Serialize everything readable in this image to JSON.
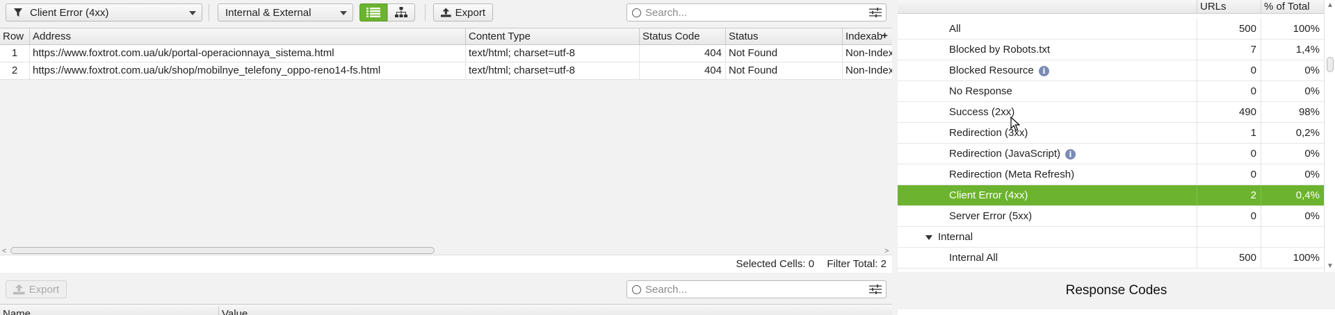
{
  "toolbar": {
    "filter_select": "Client Error (4xx)",
    "scope_select": "Internal & External",
    "export_label": "Export",
    "search_placeholder": "Search..."
  },
  "grid": {
    "columns": [
      "Row",
      "Address",
      "Content Type",
      "Status Code",
      "Status",
      "Indexab"
    ],
    "rows": [
      {
        "row": "1",
        "address": "https://www.foxtrot.com.ua/uk/portal-operacionnaya_sistema.html",
        "content_type": "text/html; charset=utf-8",
        "status_code": "404",
        "status": "Not Found",
        "indexability": "Non-Indexable"
      },
      {
        "row": "2",
        "address": "https://www.foxtrot.com.ua/uk/shop/mobilnye_telefony_oppo-reno14-fs.html",
        "content_type": "text/html; charset=utf-8",
        "status_code": "404",
        "status": "Not Found",
        "indexability": "Non-Indexable"
      }
    ]
  },
  "statusbar": {
    "selected_label": "Selected Cells:",
    "selected_value": "0",
    "filter_label": "Filter Total:",
    "filter_value": "2"
  },
  "lower": {
    "export_label": "Export",
    "search_placeholder": "Search...",
    "col_name": "Name",
    "col_value": "Value"
  },
  "overview": {
    "col_urls": "URLs",
    "col_pct": "% of Total",
    "rows": [
      {
        "label": "All",
        "urls": "500",
        "pct": "100%"
      },
      {
        "label": "Blocked by Robots.txt",
        "urls": "7",
        "pct": "1,4%"
      },
      {
        "label": "Blocked Resource",
        "urls": "0",
        "pct": "0%",
        "info": true
      },
      {
        "label": "No Response",
        "urls": "0",
        "pct": "0%"
      },
      {
        "label": "Success (2xx)",
        "urls": "490",
        "pct": "98%"
      },
      {
        "label": "Redirection (3xx)",
        "urls": "1",
        "pct": "0,2%"
      },
      {
        "label": "Redirection (JavaScript)",
        "urls": "0",
        "pct": "0%",
        "info": true
      },
      {
        "label": "Redirection (Meta Refresh)",
        "urls": "0",
        "pct": "0%"
      },
      {
        "label": "Client Error (4xx)",
        "urls": "2",
        "pct": "0,4%",
        "selected": true
      },
      {
        "label": "Server Error (5xx)",
        "urls": "0",
        "pct": "0%"
      },
      {
        "label": "Internal",
        "urls": "",
        "pct": "",
        "group": true
      },
      {
        "label": "Internal All",
        "urls": "500",
        "pct": "100%"
      }
    ],
    "panel_title": "Response Codes"
  },
  "colors": {
    "accent_green": "#6cb32f",
    "info_icon": "#7b8bb5"
  },
  "icons": {
    "filter": "funnel-icon",
    "list_view": "list-icon",
    "tree_view": "tree-icon",
    "export": "upload-icon",
    "search": "search-icon",
    "settings": "sliders-icon",
    "info": "info-icon"
  }
}
